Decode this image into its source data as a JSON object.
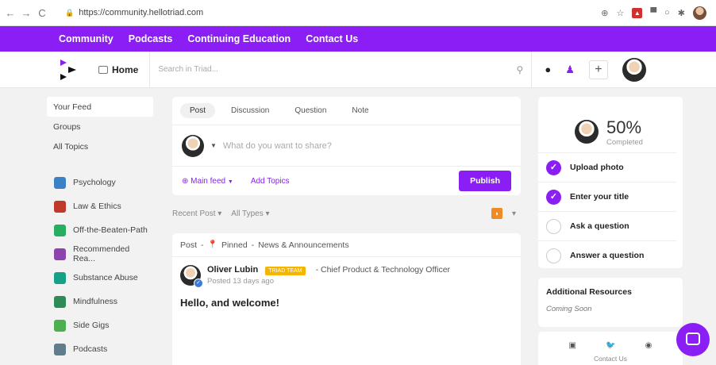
{
  "browser": {
    "back": "←",
    "forward": "→",
    "reload": "C",
    "url": "https://community.hellotriad.com"
  },
  "topnav": [
    "Community",
    "Podcasts",
    "Continuing Education",
    "Contact Us"
  ],
  "header": {
    "home_label": "Home",
    "search_placeholder": "Search in Triad..."
  },
  "sidebar": {
    "primary": [
      "Your Feed",
      "Groups",
      "All Topics"
    ],
    "topics": [
      {
        "label": "Psychology",
        "icon": "headphones-icon",
        "color": "#3b82c4"
      },
      {
        "label": "Law & Ethics",
        "icon": "scales-icon",
        "color": "#c0392b"
      },
      {
        "label": "Off-the-Beaten-Path",
        "icon": "people-icon",
        "color": "#27ae60"
      },
      {
        "label": "Recommended Rea...",
        "icon": "books-icon",
        "color": "#8e44ad"
      },
      {
        "label": "Substance Abuse",
        "icon": "pills-icon",
        "color": "#16a085"
      },
      {
        "label": "Mindfulness",
        "icon": "lotus-icon",
        "color": "#2e8b57"
      },
      {
        "label": "Side Gigs",
        "icon": "cash-icon",
        "color": "#4caf50"
      },
      {
        "label": "Podcasts",
        "icon": "mic-icon",
        "color": "#607d8b"
      }
    ]
  },
  "composer": {
    "tabs": [
      "Post",
      "Discussion",
      "Question",
      "Note"
    ],
    "placeholder": "What do you want to share?",
    "main_feed": "Main feed",
    "add_topics": "Add Topics",
    "publish": "Publish"
  },
  "filters": {
    "sort": "Recent Post",
    "type": "All Types"
  },
  "post": {
    "kind": "Post",
    "pinned": "Pinned",
    "category": "News & Announcements",
    "author": "Oliver Lubin",
    "badge": "TRIAD TEAM",
    "role": "Chief Product & Technology Officer",
    "posted": "Posted 13 days ago",
    "title": "Hello, and welcome!"
  },
  "profile_progress": {
    "percent": "50%",
    "completed_label": "Completed",
    "steps": [
      {
        "label": "Upload photo",
        "done": true
      },
      {
        "label": "Enter your title",
        "done": true
      },
      {
        "label": "Ask a question",
        "done": false
      },
      {
        "label": "Answer a question",
        "done": false
      }
    ]
  },
  "resources": {
    "title": "Additional Resources",
    "subtitle": "Coming Soon"
  },
  "footer": {
    "contact": "Contact Us"
  },
  "colors": {
    "brand": "#8a1ef5",
    "pin": "#e0443a",
    "badge": "#f4b400",
    "rss": "#f08a24"
  }
}
